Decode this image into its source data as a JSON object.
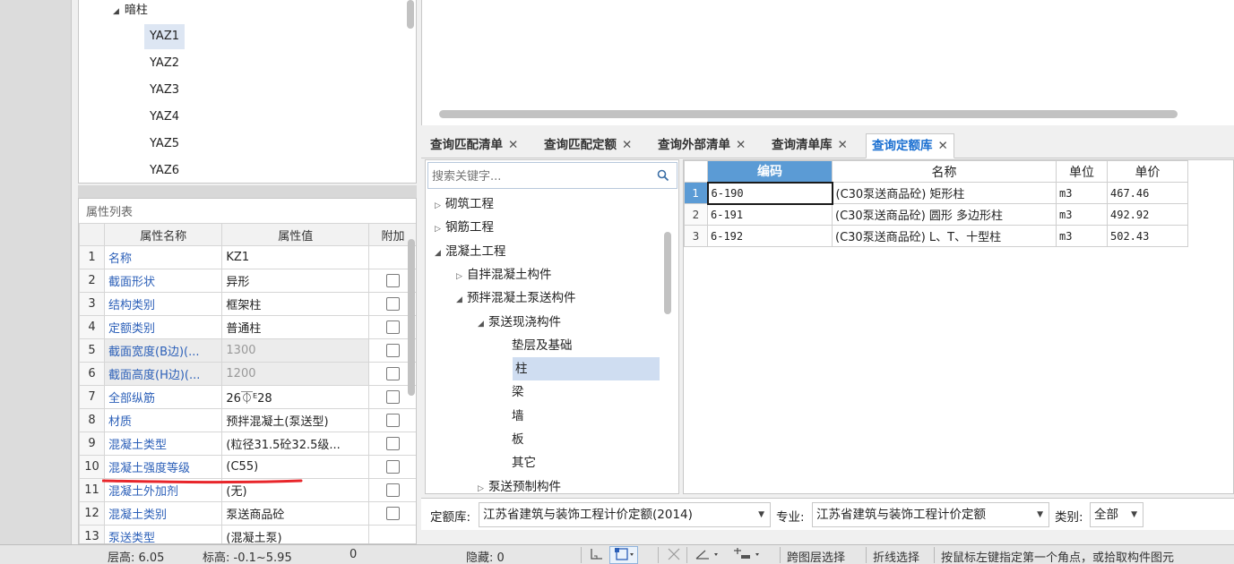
{
  "tree": {
    "group_label": "暗柱",
    "items": [
      "YAZ1",
      "YAZ2",
      "YAZ3",
      "YAZ4",
      "YAZ5",
      "YAZ6"
    ],
    "selected_item": "YAZ1"
  },
  "properties": {
    "panel_title": "属性列表",
    "headers": {
      "name": "属性名称",
      "value": "属性值",
      "extra": "附加"
    },
    "rows": [
      {
        "idx": "1",
        "name": "名称",
        "value": "KZ1"
      },
      {
        "idx": "2",
        "name": "截面形状",
        "value": "异形"
      },
      {
        "idx": "3",
        "name": "结构类别",
        "value": "框架柱"
      },
      {
        "idx": "4",
        "name": "定额类别",
        "value": "普通柱"
      },
      {
        "idx": "5",
        "name": "截面宽度(B边)(...",
        "value": "1300"
      },
      {
        "idx": "6",
        "name": "截面高度(H边)(...",
        "value": "1200"
      },
      {
        "idx": "7",
        "name": "全部纵筋",
        "value": "26⏁ᴱ28"
      },
      {
        "idx": "8",
        "name": "材质",
        "value": "预拌混凝土(泵送型)"
      },
      {
        "idx": "9",
        "name": "混凝土类型",
        "value": "(粒径31.5砼32.5级..."
      },
      {
        "idx": "10",
        "name": "混凝土强度等级",
        "value": "(C55)"
      },
      {
        "idx": "11",
        "name": "混凝土外加剂",
        "value": "(无)"
      },
      {
        "idx": "12",
        "name": "混凝土类别",
        "value": "泵送商品砼"
      },
      {
        "idx": "13",
        "name": "泵送类型",
        "value": "(混凝土泵)"
      }
    ]
  },
  "tabs": [
    {
      "label": "查询匹配清单",
      "active": false
    },
    {
      "label": "查询匹配定额",
      "active": false
    },
    {
      "label": "查询外部清单",
      "active": false
    },
    {
      "label": "查询清单库",
      "active": false
    },
    {
      "label": "查询定额库",
      "active": true
    }
  ],
  "search": {
    "placeholder": "搜索关键字..."
  },
  "category_tree": [
    {
      "label": "砌筑工程",
      "level": 0,
      "state": "collapsed"
    },
    {
      "label": "钢筋工程",
      "level": 0,
      "state": "collapsed"
    },
    {
      "label": "混凝土工程",
      "level": 0,
      "state": "expanded"
    },
    {
      "label": "自拌混凝土构件",
      "level": 1,
      "state": "collapsed"
    },
    {
      "label": "预拌混凝土泵送构件",
      "level": 1,
      "state": "expanded"
    },
    {
      "label": "泵送现浇构件",
      "level": 2,
      "state": "expanded"
    },
    {
      "label": "垫层及基础",
      "level": 3,
      "state": "leaf"
    },
    {
      "label": "柱",
      "level": 3,
      "state": "leaf",
      "selected": true
    },
    {
      "label": "梁",
      "level": 3,
      "state": "leaf"
    },
    {
      "label": "墙",
      "level": 3,
      "state": "leaf"
    },
    {
      "label": "板",
      "level": 3,
      "state": "leaf"
    },
    {
      "label": "其它",
      "level": 3,
      "state": "leaf"
    },
    {
      "label": "泵送预制构件",
      "level": 2,
      "state": "collapsed"
    }
  ],
  "grid": {
    "headers": {
      "code": "编码",
      "name": "名称",
      "unit": "单位",
      "price": "单价"
    },
    "rows": [
      {
        "rn": "1",
        "code": "6-190",
        "name": "(C30泵送商品砼) 矩形柱",
        "unit": "m3",
        "price": "467.46"
      },
      {
        "rn": "2",
        "code": "6-191",
        "name": "(C30泵送商品砼) 圆形 多边形柱",
        "unit": "m3",
        "price": "492.92"
      },
      {
        "rn": "3",
        "code": "6-192",
        "name": "(C30泵送商品砼) L、T、十型柱",
        "unit": "m3",
        "price": "502.43"
      }
    ]
  },
  "filters": {
    "quota_lib_label": "定额库:",
    "quota_lib_value": "江苏省建筑与装饰工程计价定额(2014)",
    "specialty_label": "专业:",
    "specialty_value": "江苏省建筑与装饰工程计价定额",
    "category_label": "类别:",
    "category_value": "全部"
  },
  "status": {
    "floor_height": "层高:  6.05",
    "elevation": "标高:  -0.1~5.95",
    "zero": "0",
    "hidden": "隐藏:  0",
    "cross_layer": "跨图层选择",
    "polyline": "折线选择",
    "hint": "按鼠标左键指定第一个角点，或拾取构件图元"
  },
  "colors": {
    "accent": "#1a6fd1",
    "header_blue": "#5b9bd5",
    "link_blue": "#2b5fb8",
    "annotation_red": "#e8262b"
  }
}
